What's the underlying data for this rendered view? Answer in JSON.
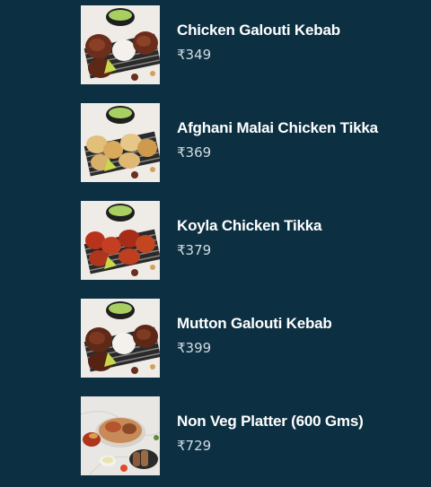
{
  "menu": {
    "items": [
      {
        "name": "Chicken Galouti Kebab",
        "price": "₹349",
        "image": "kebab-platter-image"
      },
      {
        "name": "Afghani Malai Chicken Tikka",
        "price": "₹369",
        "image": "malai-tikka-platter-image"
      },
      {
        "name": "Koyla Chicken Tikka",
        "price": "₹379",
        "image": "koyla-tikka-platter-image"
      },
      {
        "name": "Mutton Galouti Kebab",
        "price": "₹399",
        "image": "mutton-kebab-platter-image"
      },
      {
        "name": "Non Veg Platter (600 Gms)",
        "price": "₹729",
        "image": "non-veg-platter-image"
      }
    ]
  },
  "colors": {
    "background": "#0c3042",
    "name_text": "#ffffff",
    "price_text": "#d2dce2"
  }
}
